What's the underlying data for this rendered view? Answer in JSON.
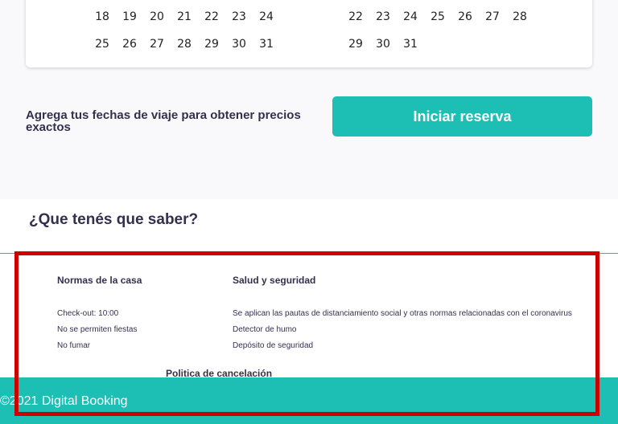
{
  "calendar": {
    "month_a": [
      [
        "18",
        "19",
        "20",
        "21",
        "22",
        "23",
        "24"
      ],
      [
        "25",
        "26",
        "27",
        "28",
        "29",
        "30",
        "31"
      ]
    ],
    "month_b": [
      [
        "22",
        "23",
        "24",
        "25",
        "26",
        "27",
        "28"
      ],
      [
        "29",
        "30",
        "31"
      ]
    ]
  },
  "reserve": {
    "prompt": "Agrega tus fechas de viaje para obtener precios exactos",
    "button_label": "Iniciar reserva"
  },
  "know": {
    "title": "¿Que tenés que saber?",
    "house_rules": {
      "heading": "Normas de la casa",
      "items": [
        "Check-out: 10:00",
        "No se permiten fiestas",
        "No fumar"
      ]
    },
    "health_safety": {
      "heading": "Salud y seguridad",
      "items": [
        "Se aplican las pautas de distanciamiento social y otras normas relacionadas con el coronavirus",
        "Detector de humo",
        "Depósito de seguridad"
      ]
    },
    "cancellation": {
      "heading": "Politica de cancelación"
    }
  },
  "footer": {
    "copyright": "©2021 Digital Booking"
  },
  "colors": {
    "accent": "#1dbeb4",
    "text": "#33304d",
    "highlight": "#cc0000"
  }
}
